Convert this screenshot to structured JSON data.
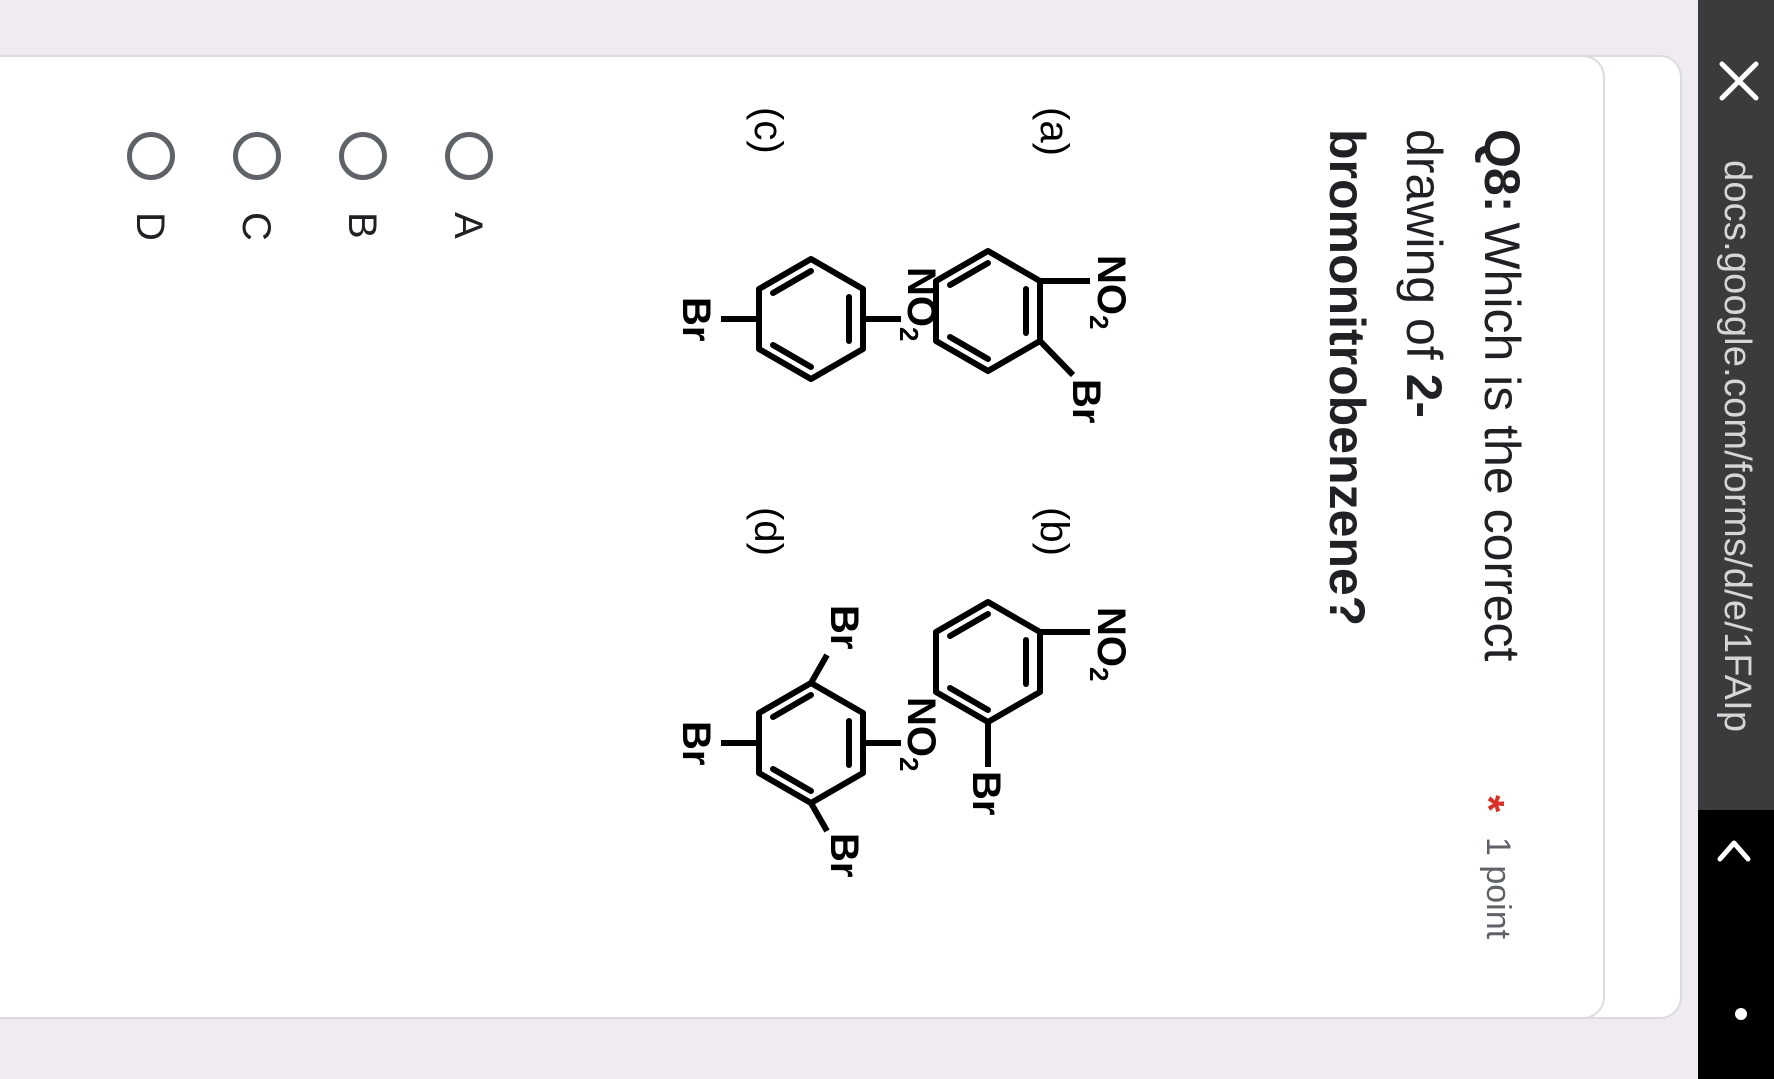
{
  "browser": {
    "url": "docs.google.com/forms/d/e/1FAIp",
    "close_icon": "close-icon",
    "back_icon": "back-icon"
  },
  "question": {
    "number": "Q8:",
    "text_line1": "Which is the correct",
    "text_line2_prefix": "drawing of ",
    "text_line2_bold": "2-",
    "text_line3_bold": "bromonitrobenzene?",
    "required_mark": "*",
    "points": "1 point"
  },
  "structures": {
    "a_label": "(a)",
    "b_label": "(b)",
    "c_label": "(c)",
    "d_label": "(d)",
    "no2_main": "NO",
    "no2_sub": "2",
    "br": "Br"
  },
  "options": [
    {
      "label": "A",
      "selected": false
    },
    {
      "label": "B",
      "selected": false
    },
    {
      "label": "C",
      "selected": false
    },
    {
      "label": "D",
      "selected": false
    }
  ],
  "colors": {
    "background": "#f0ebf1",
    "card": "#ffffff",
    "required": "#d93025",
    "address_bar": "#3b3b3d"
  }
}
